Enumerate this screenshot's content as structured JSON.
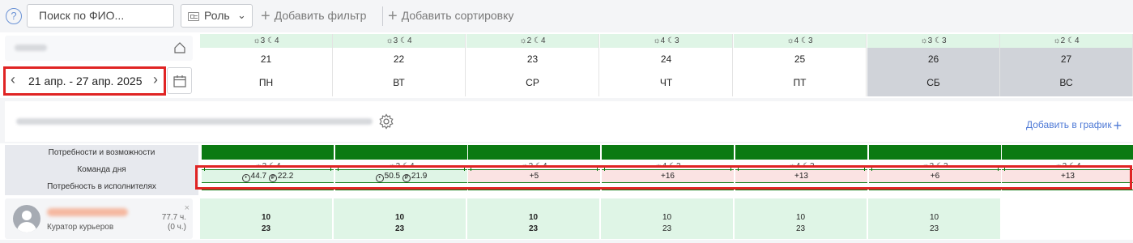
{
  "toolbar": {
    "help_label": "?",
    "search_placeholder": "Поиск по ФИО...",
    "role_label": "Роль",
    "add_filter": "Добавить фильтр",
    "add_sort": "Добавить сортировку"
  },
  "period": {
    "label": "21 апр. - 27 апр. 2025"
  },
  "days": [
    {
      "weather": "☼3 ☾4",
      "num": "21",
      "weekday": "ПН",
      "weekend": false
    },
    {
      "weather": "☼3 ☾4",
      "num": "22",
      "weekday": "ВТ",
      "weekend": false
    },
    {
      "weather": "☼2 ☾4",
      "num": "23",
      "weekday": "СР",
      "weekend": false
    },
    {
      "weather": "☼4 ☾3",
      "num": "24",
      "weekday": "ЧТ",
      "weekend": false
    },
    {
      "weather": "☼4 ☾3",
      "num": "25",
      "weekday": "ПТ",
      "weekend": false
    },
    {
      "weather": "☼3 ☾3",
      "num": "26",
      "weekday": "СБ",
      "weekend": true
    },
    {
      "weather": "☼2 ☾4",
      "num": "27",
      "weekday": "ВС",
      "weekend": true
    }
  ],
  "section": {
    "add_to_graph": "Добавить в график"
  },
  "row_labels": {
    "needs": "Потребности и возможности",
    "team": "Команда дня",
    "demand": "Потребность в исполнителях"
  },
  "team_day": [
    {
      "hours": "44.7",
      "money": "22.2",
      "diff": "",
      "state": "pos"
    },
    {
      "hours": "50.5",
      "money": "21.9",
      "diff": "",
      "state": "pos"
    },
    {
      "hours": "",
      "money": "",
      "diff": "+5",
      "state": "neg"
    },
    {
      "hours": "",
      "money": "",
      "diff": "+16",
      "state": "neg"
    },
    {
      "hours": "",
      "money": "",
      "diff": "+13",
      "state": "neg"
    },
    {
      "hours": "",
      "money": "",
      "diff": "+6",
      "state": "neg"
    },
    {
      "hours": "",
      "money": "",
      "diff": "+13",
      "state": "neg"
    }
  ],
  "employee": {
    "role": "Куратор курьеров",
    "hours": "77.7 ч.",
    "hours_sub": "(0 ч.)",
    "close": "×",
    "shifts": [
      {
        "start": "10",
        "end": "23",
        "bold": true
      },
      {
        "start": "10",
        "end": "23",
        "bold": true
      },
      {
        "start": "10",
        "end": "23",
        "bold": true
      },
      {
        "start": "10",
        "end": "23",
        "bold": false
      },
      {
        "start": "10",
        "end": "23",
        "bold": false
      },
      {
        "start": "10",
        "end": "23",
        "bold": false
      },
      {
        "start": "",
        "end": "",
        "bold": false
      }
    ]
  },
  "colors": {
    "accent": "#4f7ad6",
    "highlight": "#e02424",
    "green": "#0b7a12",
    "light_green": "#dff5e6",
    "light_red": "#fbe3e3",
    "weekend": "#d0d3d9"
  }
}
